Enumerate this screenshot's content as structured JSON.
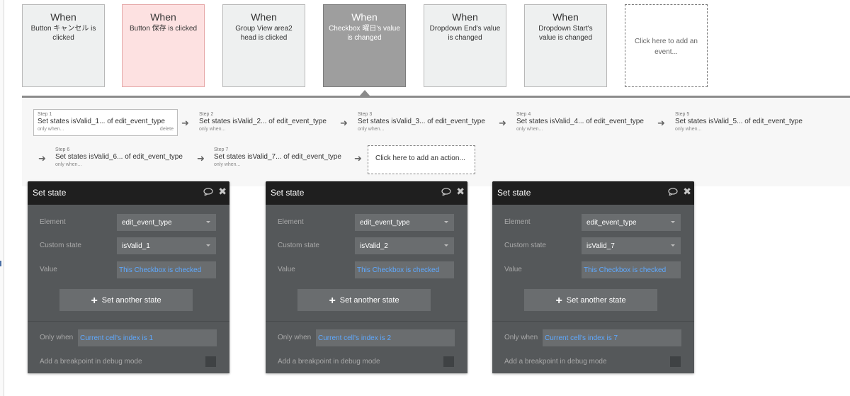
{
  "events": [
    {
      "when": "When",
      "desc": "Button キャンセル is clicked",
      "style": "default"
    },
    {
      "when": "When",
      "desc": "Button 保存 is clicked",
      "style": "pink"
    },
    {
      "when": "When",
      "desc": "Group View area2 head is clicked",
      "style": "default"
    },
    {
      "when": "When",
      "desc": "Checkbox 曜日's value is changed",
      "style": "selected"
    },
    {
      "when": "When",
      "desc": "Dropdown End's value is changed",
      "style": "default"
    },
    {
      "when": "When",
      "desc": "Dropdown Start's value is changed",
      "style": "default"
    },
    {
      "when": "",
      "desc": "Click here to add an event...",
      "style": "add"
    }
  ],
  "steps": [
    {
      "label": "Step 1",
      "title": "Set states isValid_1... of edit_event_type",
      "sub": "only when...",
      "delete": "delete"
    },
    {
      "label": "Step 2",
      "title": "Set states isValid_2... of edit_event_type",
      "sub": "only when..."
    },
    {
      "label": "Step 3",
      "title": "Set states isValid_3... of edit_event_type",
      "sub": "only when..."
    },
    {
      "label": "Step 4",
      "title": "Set states isValid_4... of edit_event_type",
      "sub": "only when..."
    },
    {
      "label": "Step 5",
      "title": "Set states isValid_5... of edit_event_type",
      "sub": "only when..."
    },
    {
      "label": "Step 6",
      "title": "Set states isValid_6... of edit_event_type",
      "sub": "only when..."
    },
    {
      "label": "Step 7",
      "title": "Set states isValid_7... of edit_event_type",
      "sub": "only when..."
    }
  ],
  "add_action": "Click here to add an action...",
  "panels": [
    {
      "title": "Set state",
      "element_label": "Element",
      "element": "edit_event_type",
      "state_label": "Custom state",
      "state": "isValid_1",
      "value_label": "Value",
      "value": "This Checkbox is checked",
      "add_state": "Set another state",
      "only_when_label": "Only when",
      "only_when": "Current cell's index is 1",
      "breakpoint": "Add a breakpoint in debug mode"
    },
    {
      "title": "Set state",
      "element_label": "Element",
      "element": "edit_event_type",
      "state_label": "Custom state",
      "state": "isValid_2",
      "value_label": "Value",
      "value": "This Checkbox is checked",
      "add_state": "Set another state",
      "only_when_label": "Only when",
      "only_when": "Current cell's index is 2",
      "breakpoint": "Add a breakpoint in debug mode"
    },
    {
      "title": "Set state",
      "element_label": "Element",
      "element": "edit_event_type",
      "state_label": "Custom state",
      "state": "isValid_7",
      "value_label": "Value",
      "value": "This Checkbox is checked",
      "add_state": "Set another state",
      "only_when_label": "Only when",
      "only_when": "Current cell's index is 7",
      "breakpoint": "Add a breakpoint in debug mode"
    }
  ],
  "icons": {
    "arrow": "arrow-right-icon",
    "comment": "comment-icon",
    "close": "close-icon",
    "plus": "plus-icon",
    "chevron": "chevron-down-icon"
  },
  "colors": {
    "selected_event": "#9e9e9e",
    "pink_event": "#fde1e1",
    "panel_header": "#1f1f1f",
    "panel_body": "#55585a",
    "link": "#5ea9ff"
  }
}
